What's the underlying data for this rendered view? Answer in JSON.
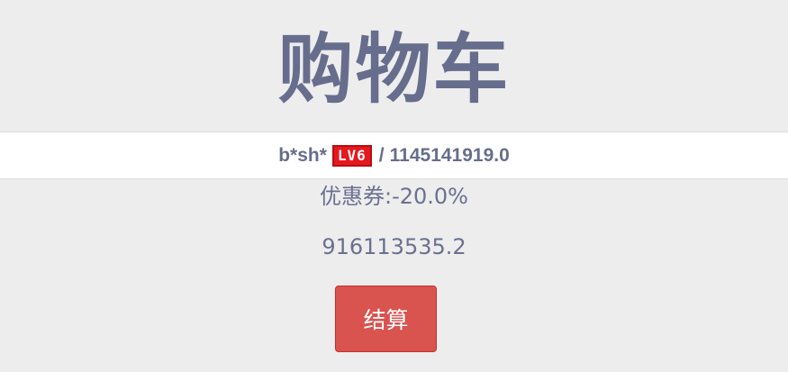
{
  "title": "购物车",
  "user": {
    "name": "b*sh*",
    "level_badge": "LV6",
    "separator": "/",
    "balance": "1145141919.0"
  },
  "coupon": {
    "text": "优惠券:-20.0%"
  },
  "total": {
    "amount": "916113535.2"
  },
  "actions": {
    "checkout_label": "结算"
  },
  "colors": {
    "background": "#ededed",
    "text": "#676d8d",
    "badge": "#e6181f",
    "checkout_button": "#d9534f"
  }
}
